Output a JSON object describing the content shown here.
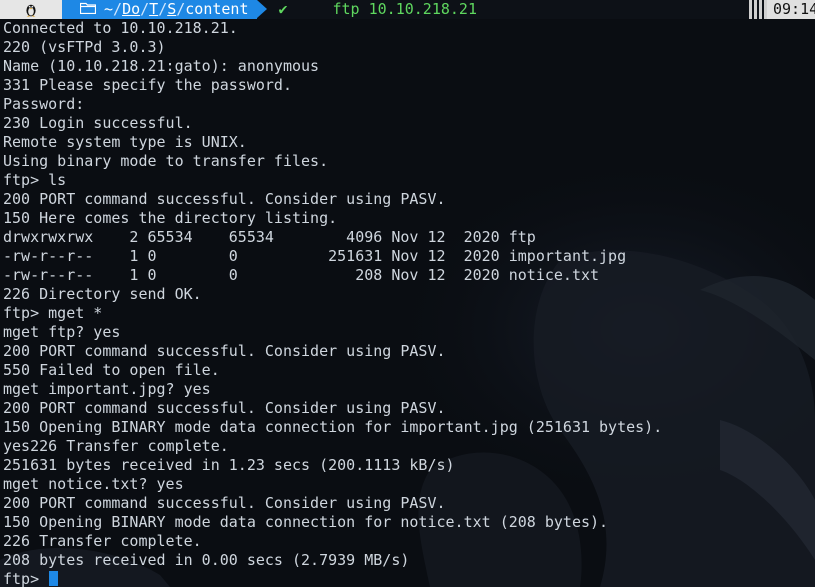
{
  "prompt": {
    "os_icon": "linux-penguin-icon",
    "folder_icon": "folder-icon",
    "path_tilde": "~",
    "path_parts": [
      "Do",
      "T",
      "S",
      "content"
    ],
    "path_separator": "/",
    "status_icon": "checkmark-icon",
    "status_glyph": "✔",
    "command": "ftp 10.10.218.21",
    "time": "09:14"
  },
  "terminal": {
    "lines": [
      "Connected to 10.10.218.21.",
      "220 (vsFTPd 3.0.3)",
      "Name (10.10.218.21:gato): anonymous",
      "331 Please specify the password.",
      "Password:",
      "230 Login successful.",
      "Remote system type is UNIX.",
      "Using binary mode to transfer files.",
      "ftp> ls",
      "200 PORT command successful. Consider using PASV.",
      "150 Here comes the directory listing.",
      "drwxrwxrwx    2 65534    65534        4096 Nov 12  2020 ftp",
      "-rw-r--r--    1 0        0          251631 Nov 12  2020 important.jpg",
      "-rw-r--r--    1 0        0             208 Nov 12  2020 notice.txt",
      "226 Directory send OK.",
      "ftp> mget *",
      "mget ftp? yes",
      "200 PORT command successful. Consider using PASV.",
      "550 Failed to open file.",
      "mget important.jpg? yes",
      "200 PORT command successful. Consider using PASV.",
      "150 Opening BINARY mode data connection for important.jpg (251631 bytes).",
      "yes226 Transfer complete.",
      "251631 bytes received in 1.23 secs (200.1113 kB/s)",
      "mget notice.txt? yes",
      "200 PORT command successful. Consider using PASV.",
      "150 Opening BINARY mode data connection for notice.txt (208 bytes).",
      "226 Transfer complete.",
      "208 bytes received in 0.00 secs (2.7939 MB/s)"
    ],
    "current_prompt": "ftp> ",
    "cursor_color": "#1e88e5"
  },
  "colors": {
    "background": "#0a0d12",
    "text": "#cfd6de",
    "dir_segment": "#1e88e5",
    "command_green": "#5fd75f",
    "os_segment": "#e6e6e6"
  }
}
